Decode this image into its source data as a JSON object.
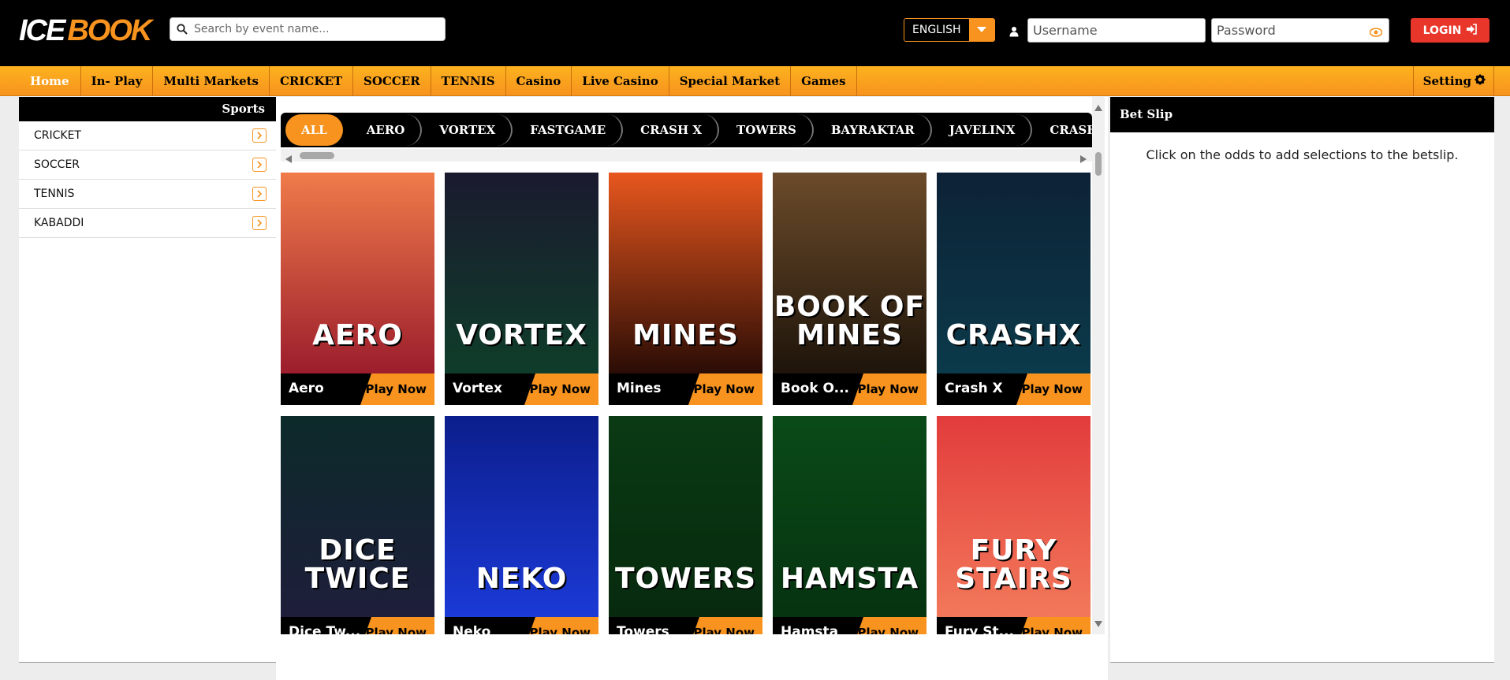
{
  "brand": {
    "part1": "ICE",
    "part2": "BOOK"
  },
  "search": {
    "placeholder": "Search by event name..."
  },
  "language": {
    "selected": "ENGLISH"
  },
  "login": {
    "username_placeholder": "Username",
    "password_placeholder": "Password",
    "button_label": "LOGIN"
  },
  "nav": {
    "items": [
      "Home",
      "In- Play",
      "Multi Markets",
      "CRICKET",
      "SOCCER",
      "TENNIS",
      "Casino",
      "Live Casino",
      "Special Market",
      "Games"
    ],
    "setting_label": "Setting"
  },
  "sidebar": {
    "title": "Sports",
    "items": [
      "CRICKET",
      "SOCCER",
      "TENNIS",
      "KABADDI"
    ]
  },
  "tabs": [
    "ALL",
    "AERO",
    "VORTEX",
    "FASTGAME",
    "CRASH X",
    "TOWERS",
    "BAYRAKTAR",
    "JAVELINX",
    "CRASH X FOOTBALL"
  ],
  "games": [
    {
      "name": "Aero",
      "art_text": "AERO",
      "play_label": "Play Now",
      "color_top": "#f07b4a",
      "color_bottom": "#9c1d2c"
    },
    {
      "name": "Vortex",
      "art_text": "VORTEX",
      "play_label": "Play Now",
      "color_top": "#1a1a2e",
      "color_bottom": "#0f3d2a"
    },
    {
      "name": "Mines",
      "art_text": "MINES",
      "play_label": "Play Now",
      "color_top": "#e8571e",
      "color_bottom": "#2a0c05"
    },
    {
      "name": "Book O...",
      "art_text": "BOOK OF MINES",
      "play_label": "Play Now",
      "color_top": "#6b4b2a",
      "color_bottom": "#1e140a"
    },
    {
      "name": "Crash X",
      "art_text": "CRASHX",
      "play_label": "Play Now",
      "color_top": "#0d2236",
      "color_bottom": "#0b3a4a"
    },
    {
      "name": "Dice Tw...",
      "art_text": "DICE TWICE",
      "play_label": "Play Now",
      "color_top": "#0c2a2a",
      "color_bottom": "#1e1e3a"
    },
    {
      "name": "Neko",
      "art_text": "NEKO",
      "play_label": "Play Now",
      "color_top": "#0c1e8c",
      "color_bottom": "#1b3ad6"
    },
    {
      "name": "Towers",
      "art_text": "TOWERS",
      "play_label": "Play Now",
      "color_top": "#0a3a14",
      "color_bottom": "#072a0e"
    },
    {
      "name": "Hamsta",
      "art_text": "HAMSTA",
      "play_label": "Play Now",
      "color_top": "#0a4a18",
      "color_bottom": "#063310"
    },
    {
      "name": "Fury St...",
      "art_text": "FURY STAIRS",
      "play_label": "Play Now",
      "color_top": "#e23c3c",
      "color_bottom": "#f2785a"
    }
  ],
  "betslip": {
    "title": "Bet Slip",
    "message": "Click on the odds to add selections to the betslip."
  },
  "colors": {
    "accent": "#f7931e",
    "login": "#e8362b",
    "header": "#000000"
  }
}
